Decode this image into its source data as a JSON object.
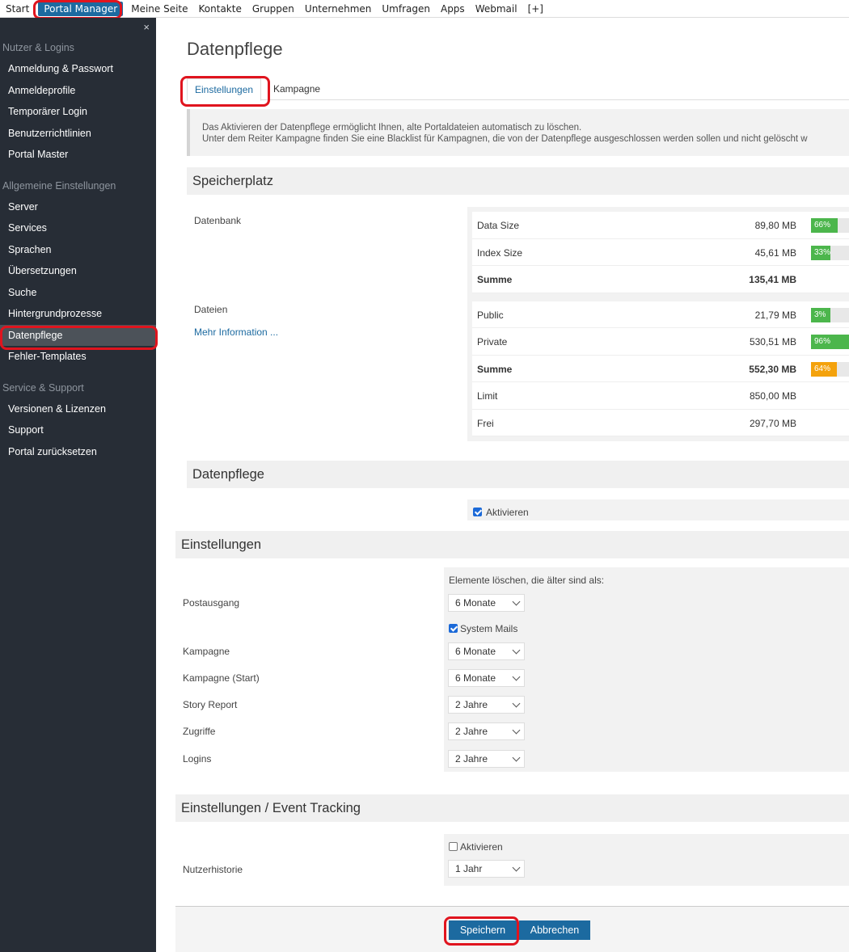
{
  "topnav": {
    "items": [
      "Start",
      "Portal Manager",
      "Meine Seite",
      "Kontakte",
      "Gruppen",
      "Unternehmen",
      "Umfragen",
      "Apps",
      "Webmail",
      "[+]"
    ],
    "active_index": 1
  },
  "sidebar": {
    "close_glyph": "×",
    "groups": [
      {
        "title": "Nutzer & Logins",
        "items": [
          "Anmeldung & Passwort",
          "Anmeldeprofile",
          "Temporärer Login",
          "Benutzerrichtlinien",
          "Portal Master"
        ]
      },
      {
        "title": "Allgemeine Einstellungen",
        "items": [
          "Server",
          "Services",
          "Sprachen",
          "Übersetzungen",
          "Suche",
          "Hintergrundprozesse",
          "Datenpflege",
          "Fehler-Templates"
        ]
      },
      {
        "title": "Service & Support",
        "items": [
          "Versionen & Lizenzen",
          "Support",
          "Portal zurücksetzen"
        ]
      }
    ],
    "active_item": "Datenpflege"
  },
  "page": {
    "title": "Datenpflege",
    "tabs": [
      "Einstellungen",
      "Kampagne"
    ],
    "active_tab": "Einstellungen",
    "info": {
      "line1": "Das Aktivieren der Datenpflege ermöglicht Ihnen, alte Portaldateien automatisch zu löschen.",
      "line2": "Unter dem Reiter Kampagne finden Sie eine Blacklist für Kampagnen, die von der Datenpflege ausgeschlossen werden sollen und nicht gelöscht w"
    }
  },
  "storage": {
    "section_title": "Speicherplatz",
    "datenbank_label": "Datenbank",
    "dateien_label": "Dateien",
    "more_link": "Mehr Information ...",
    "datenbank_rows": [
      {
        "name": "Data Size",
        "value": "89,80 MB",
        "percent": 66,
        "pct_label": "66%",
        "color": "#4cb64c"
      },
      {
        "name": "Index Size",
        "value": "45,61 MB",
        "percent": 33,
        "pct_label": "33%",
        "color": "#4cb64c"
      },
      {
        "name": "Summe",
        "value": "135,41 MB",
        "bold": true
      }
    ],
    "dateien_rows": [
      {
        "name": "Public",
        "value": "21,79 MB",
        "percent": 3,
        "pct_label": "3%",
        "color": "#4cb64c"
      },
      {
        "name": "Private",
        "value": "530,51 MB",
        "percent": 96,
        "pct_label": "96%",
        "color": "#4cb64c"
      },
      {
        "name": "Summe",
        "value": "552,30 MB",
        "percent": 64,
        "pct_label": "64%",
        "color": "#f4a20c",
        "bold": true
      },
      {
        "name": "Limit",
        "value": "850,00 MB"
      },
      {
        "name": "Frei",
        "value": "297,70 MB"
      }
    ]
  },
  "datenpflege": {
    "section_title": "Datenpflege",
    "activate_label": "Aktivieren",
    "activated": true
  },
  "einstellungen": {
    "section_title": "Einstellungen",
    "hint": "Elemente löschen, die älter sind als:",
    "postausgang_label": "Postausgang",
    "postausgang_value": "6 Monate",
    "system_mails_label": "System Mails",
    "system_mails_checked": true,
    "rows": [
      {
        "label": "Kampagne",
        "value": "6 Monate"
      },
      {
        "label": "Kampagne (Start)",
        "value": "6 Monate"
      },
      {
        "label": "Story Report",
        "value": "2 Jahre"
      },
      {
        "label": "Zugriffe",
        "value": "2 Jahre"
      },
      {
        "label": "Logins",
        "value": "2 Jahre"
      }
    ]
  },
  "event_tracking": {
    "section_title": "Einstellungen / Event Tracking",
    "activate_label": "Aktivieren",
    "activated": false,
    "nutzerhistorie_label": "Nutzerhistorie",
    "nutzerhistorie_value": "1 Jahr"
  },
  "actions": {
    "save": "Speichern",
    "cancel": "Abbrechen"
  },
  "colors": {
    "accent": "#1c6aa0",
    "sidebar_bg": "#272d36",
    "highlight": "#e0141e",
    "bar_green": "#4cb64c",
    "bar_orange": "#f4a20c"
  }
}
